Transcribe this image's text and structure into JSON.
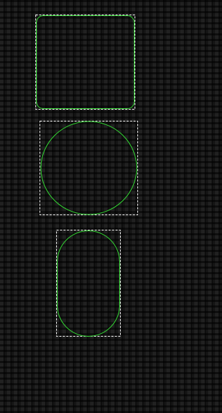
{
  "style": {
    "background": "#151515",
    "shape_stroke": "#33dd33",
    "selection_stroke": "#ffffff"
  },
  "shapes": [
    {
      "kind": "rounded-rectangle"
    },
    {
      "kind": "circle"
    },
    {
      "kind": "pill"
    }
  ]
}
